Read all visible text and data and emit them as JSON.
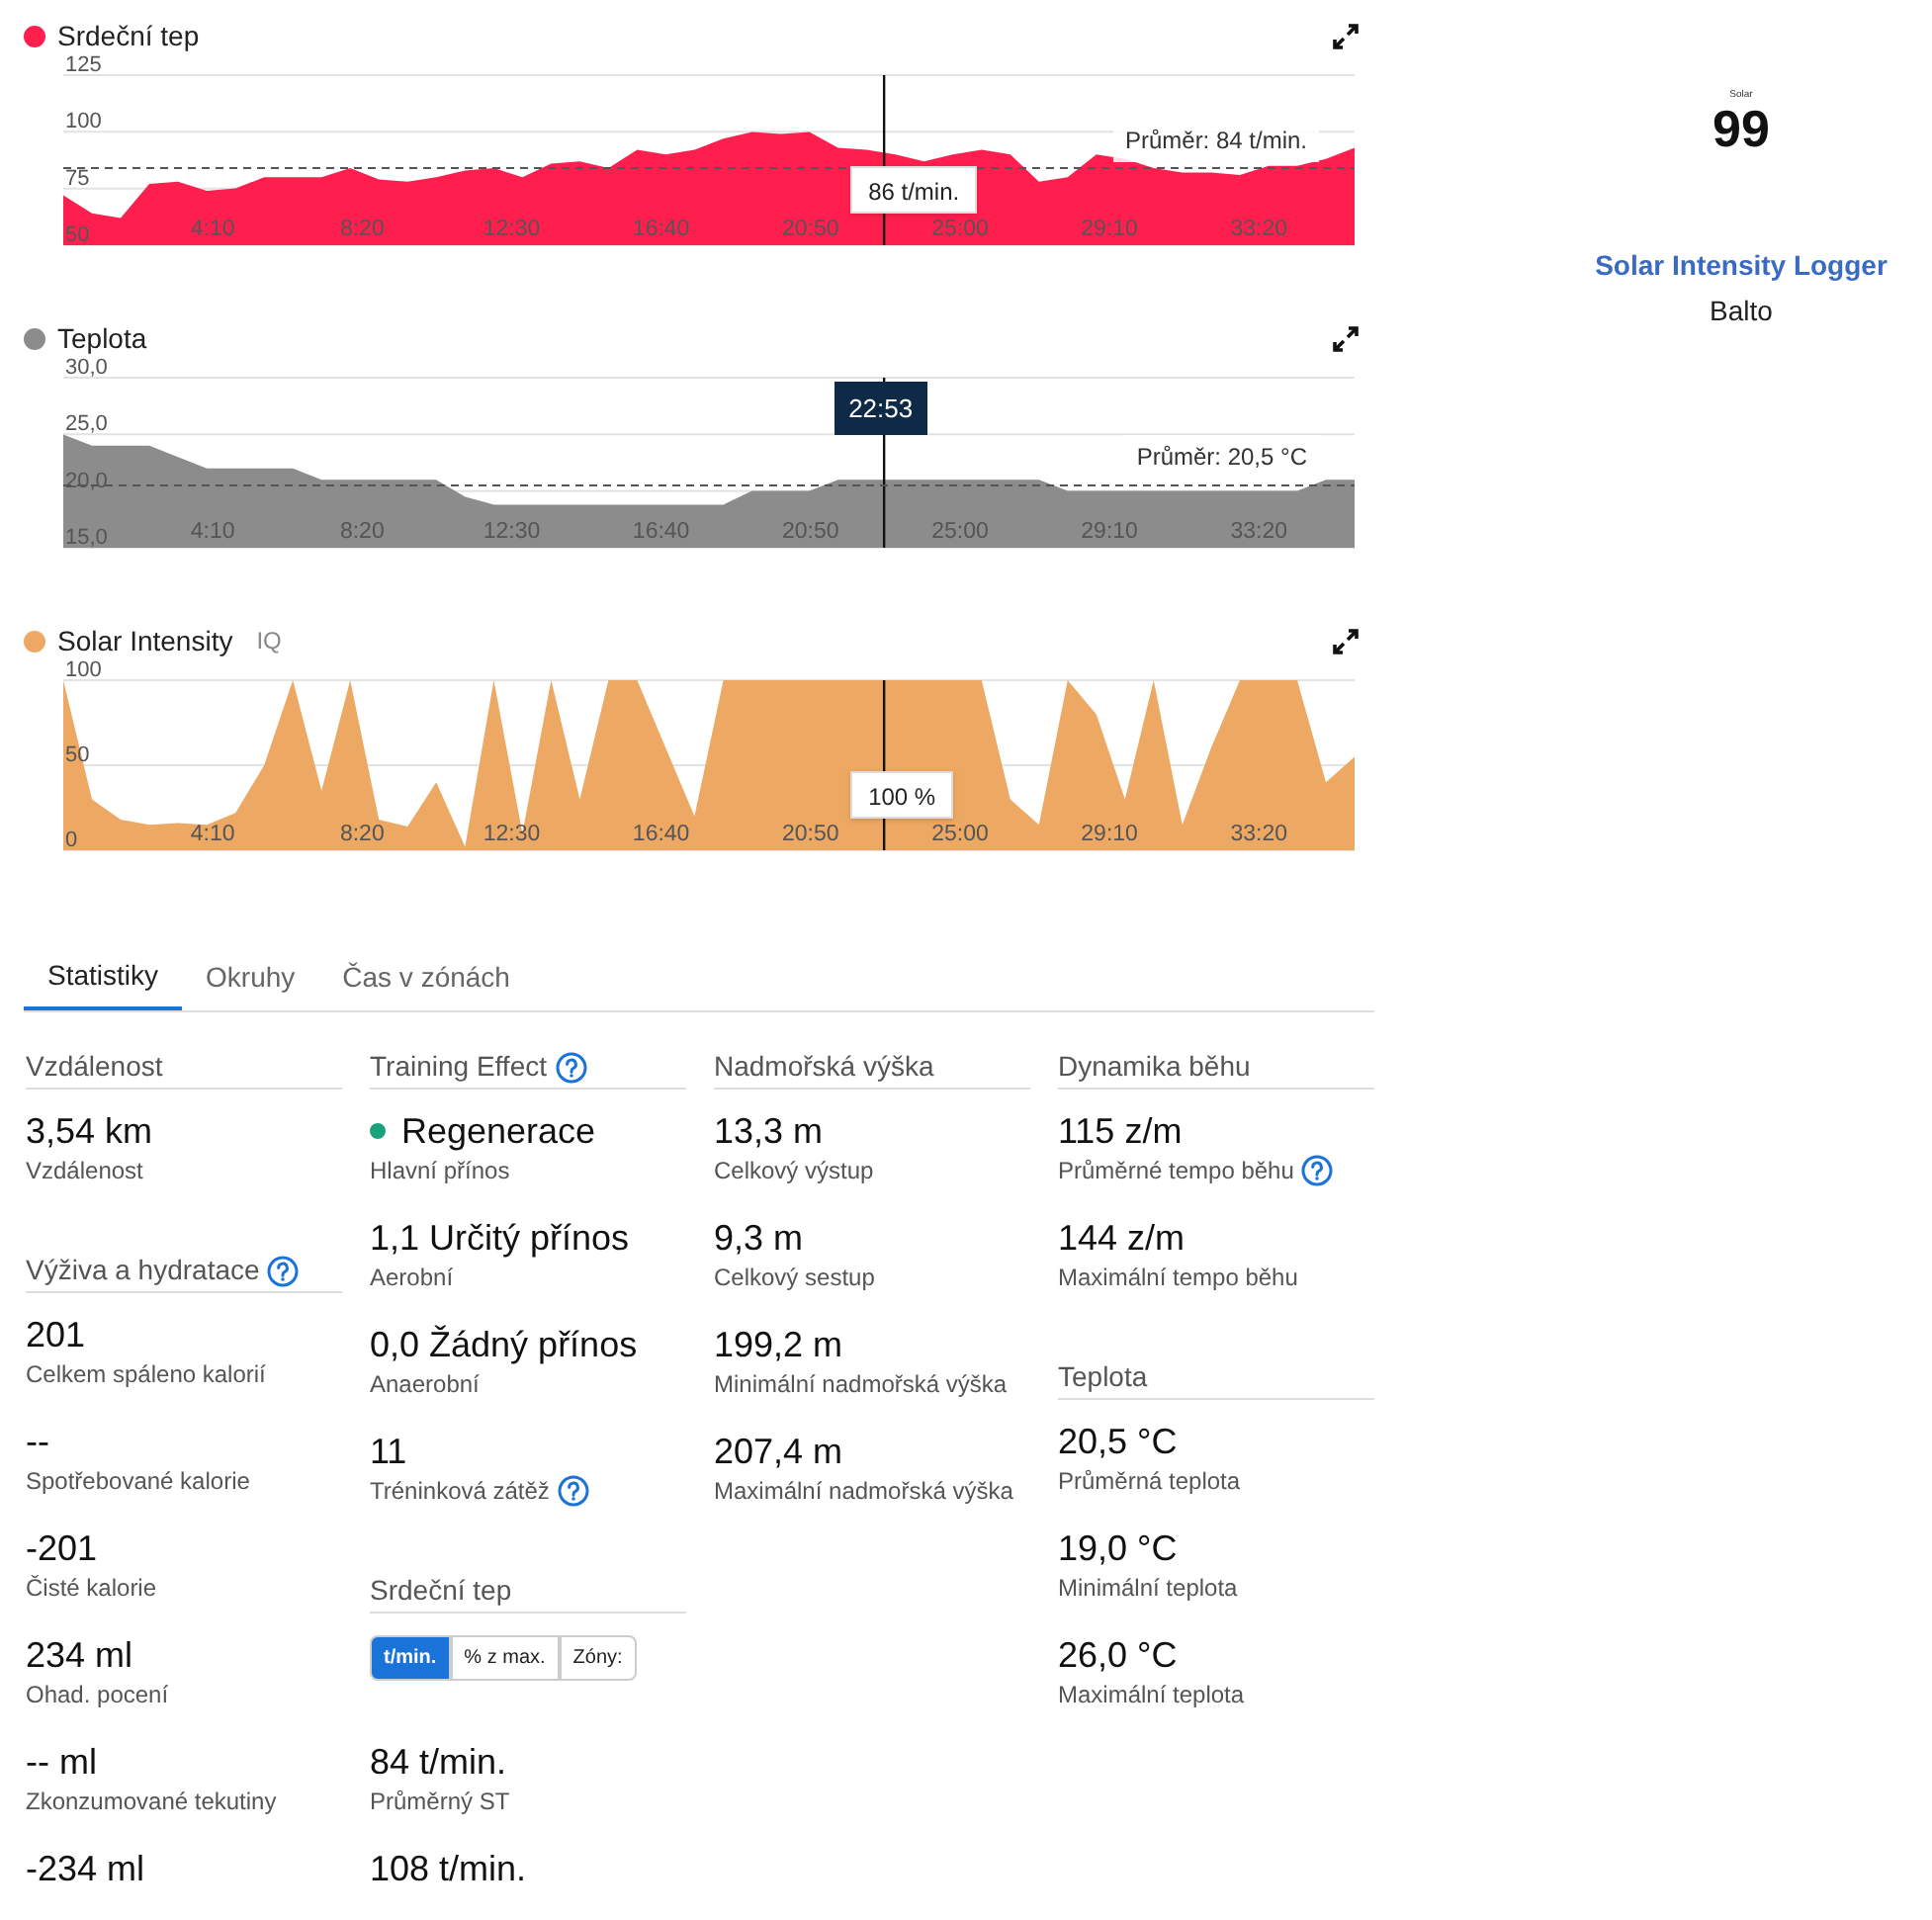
{
  "charts": [
    {
      "tooltip": "86 t/min.",
      "chart_data": {
        "type": "area",
        "xlim": [
          0,
          2160
        ],
        "ylim": [
          50,
          125
        ],
        "yticks": [
          50,
          75,
          100,
          125
        ],
        "xticks": [
          {
            "value": 250,
            "label": "4:10"
          },
          {
            "value": 500,
            "label": "8:20"
          },
          {
            "value": 750,
            "label": "12:30"
          },
          {
            "value": 1000,
            "label": "16:40"
          },
          {
            "value": 1250,
            "label": "20:50"
          },
          {
            "value": 1500,
            "label": "25:00"
          },
          {
            "value": 1750,
            "label": "29:10"
          },
          {
            "value": 2000,
            "label": "33:20"
          }
        ],
        "x": [
          0,
          48,
          96,
          144,
          192,
          240,
          288,
          336,
          384,
          432,
          480,
          528,
          576,
          624,
          672,
          720,
          768,
          816,
          864,
          912,
          960,
          1008,
          1056,
          1104,
          1152,
          1200,
          1248,
          1296,
          1344,
          1392,
          1440,
          1488,
          1536,
          1584,
          1632,
          1680,
          1728,
          1776,
          1824,
          1872,
          1920,
          1968,
          2016,
          2064,
          2112,
          2160
        ],
        "series": [
          {
            "name": "Srdeční tep",
            "color": "#ff1f4f",
            "values": [
              72,
              64,
              62,
              77,
              78,
              74,
              75,
              80,
              80,
              80,
              84,
              79,
              78,
              80,
              83,
              84,
              80,
              86,
              87,
              84,
              92,
              90,
              92,
              97,
              100,
              99,
              100,
              93,
              92,
              90,
              87,
              90,
              92,
              90,
              78,
              80,
              90,
              88,
              84,
              82,
              82,
              81,
              85,
              85,
              88,
              93
            ]
          }
        ],
        "ref_lines": [
          {
            "axis": "x",
            "value": 1373
          },
          {
            "axis": "y",
            "value": 84,
            "label": "Průměr: 84 t/min."
          }
        ]
      }
    },
    {
      "cursor_label": "22:53",
      "chart_data": {
        "type": "area",
        "xlim": [
          0,
          2160
        ],
        "ylim": [
          15,
          30
        ],
        "yticks": [
          {
            "value": 15,
            "label": "15,0"
          },
          {
            "value": 20,
            "label": "20,0"
          },
          {
            "value": 25,
            "label": "25,0"
          },
          {
            "value": 30,
            "label": "30,0"
          }
        ],
        "xticks": [
          {
            "value": 250,
            "label": "4:10"
          },
          {
            "value": 500,
            "label": "8:20"
          },
          {
            "value": 750,
            "label": "12:30"
          },
          {
            "value": 1000,
            "label": "16:40"
          },
          {
            "value": 1250,
            "label": "20:50"
          },
          {
            "value": 1500,
            "label": "25:00"
          },
          {
            "value": 1750,
            "label": "29:10"
          },
          {
            "value": 2000,
            "label": "33:20"
          }
        ],
        "x": [
          0,
          48,
          96,
          144,
          192,
          240,
          288,
          336,
          384,
          432,
          480,
          528,
          576,
          624,
          672,
          720,
          768,
          816,
          864,
          912,
          960,
          1008,
          1056,
          1104,
          1152,
          1200,
          1248,
          1296,
          1344,
          1392,
          1440,
          1488,
          1536,
          1584,
          1632,
          1680,
          1728,
          1776,
          1824,
          1872,
          1920,
          1968,
          2016,
          2064,
          2112,
          2160
        ],
        "series": [
          {
            "name": "Teplota",
            "color": "#8c8c8c",
            "values": [
              25,
              24,
              24,
              24,
              23,
              22,
              22,
              22,
              22,
              21,
              21,
              21,
              21,
              21,
              19.5,
              18.8,
              18.8,
              18.8,
              18.8,
              18.8,
              18.8,
              18.8,
              18.8,
              18.8,
              20,
              20,
              20,
              21,
              21,
              21,
              21,
              21,
              21,
              21,
              21,
              20,
              20,
              20,
              20,
              20,
              20,
              20,
              20,
              20,
              21,
              21
            ]
          }
        ],
        "ref_lines": [
          {
            "axis": "x",
            "value": 1373
          },
          {
            "axis": "y",
            "value": 20.5,
            "label": "Průměr: 20,5 °C"
          }
        ]
      }
    },
    {
      "badge": "IQ",
      "tooltip": "100 %",
      "chart_data": {
        "type": "area",
        "xlim": [
          0,
          2160
        ],
        "ylim": [
          0,
          100
        ],
        "yticks": [
          0,
          50,
          100
        ],
        "xticks": [
          {
            "value": 250,
            "label": "4:10"
          },
          {
            "value": 500,
            "label": "8:20"
          },
          {
            "value": 750,
            "label": "12:30"
          },
          {
            "value": 1000,
            "label": "16:40"
          },
          {
            "value": 1250,
            "label": "20:50"
          },
          {
            "value": 1500,
            "label": "25:00"
          },
          {
            "value": 1750,
            "label": "29:10"
          },
          {
            "value": 2000,
            "label": "33:20"
          }
        ],
        "x": [
          0,
          48,
          96,
          144,
          192,
          240,
          288,
          336,
          384,
          432,
          480,
          528,
          576,
          624,
          672,
          720,
          768,
          816,
          864,
          912,
          960,
          1008,
          1056,
          1104,
          1152,
          1200,
          1248,
          1296,
          1344,
          1392,
          1440,
          1488,
          1536,
          1584,
          1632,
          1680,
          1728,
          1776,
          1824,
          1872,
          1920,
          1968,
          2016,
          2064,
          2112,
          2160
        ],
        "series": [
          {
            "name": "Solar Intensity",
            "color": "#eda863",
            "values": [
              100,
              30,
              18,
              15,
              16,
              15,
              22,
              50,
              100,
              35,
              100,
              18,
              14,
              40,
              2,
              100,
              10,
              100,
              30,
              100,
              100,
              60,
              20,
              100,
              100,
              100,
              100,
              100,
              100,
              100,
              100,
              100,
              100,
              30,
              15,
              100,
              80,
              30,
              100,
              15,
              60,
              100,
              100,
              100,
              40,
              55
            ]
          }
        ],
        "ref_lines": [
          {
            "axis": "x",
            "value": 1373
          }
        ]
      }
    }
  ],
  "device": {
    "logo_caption": "Solar",
    "logo_number": "99",
    "name": "Solar Intensity Logger",
    "owner": "Balto"
  },
  "tabs": [
    {
      "label": "Statistiky",
      "selected": true
    },
    {
      "label": "Okruhy",
      "selected": false
    },
    {
      "label": "Čas v zónách",
      "selected": false
    }
  ],
  "stats": [
    {
      "sections": [
        {
          "title": "Vzdálenost",
          "help": false,
          "items": [
            {
              "value": "3,54 km",
              "label": "Vzdálenost",
              "help": false
            }
          ]
        },
        {
          "title": "Výživa a hydratace",
          "help": true,
          "items": [
            {
              "value": "201",
              "label": "Celkem spáleno kalorií",
              "help": false
            },
            {
              "value": "--",
              "label": "Spotřebované kalorie",
              "help": false
            },
            {
              "value": "-201",
              "label": "Čisté kalorie",
              "help": false
            },
            {
              "value": "234 ml",
              "label": "Ohad. pocení",
              "help": false
            },
            {
              "value": "-- ml",
              "label": "Zkonzumované tekutiny",
              "help": false
            },
            {
              "value": "-234 ml",
              "help": false
            }
          ]
        }
      ]
    },
    {
      "sections": [
        {
          "title": "Training Effect",
          "help": true,
          "items": [
            {
              "value": "Regenerace",
              "label": "Hlavní přínos",
              "help": false,
              "color": "#1aa37a"
            },
            {
              "value": "1,1 Určitý přínos",
              "label": "Aerobní",
              "help": false
            },
            {
              "value": "0,0 Žádný přínos",
              "label": "Anaerobní",
              "help": false
            },
            {
              "value": "11",
              "label": "Tréninková zátěž",
              "help": true
            }
          ]
        },
        {
          "title": "Srdeční tep",
          "help": false,
          "units": [
            {
              "label": "t/min.",
              "selected": true
            },
            {
              "label": "% z max.",
              "selected": false
            },
            {
              "label": "Zóny:",
              "selected": false
            }
          ],
          "items": [
            {
              "value": "84 t/min.",
              "label": "Průměrný ST",
              "help": false
            },
            {
              "value": "108 t/min.",
              "help": false
            }
          ]
        }
      ]
    },
    {
      "sections": [
        {
          "title": "Nadmořská výška",
          "help": false,
          "items": [
            {
              "value": "13,3 m",
              "label": "Celkový výstup",
              "help": false
            },
            {
              "value": "9,3 m",
              "label": "Celkový sestup",
              "help": false
            },
            {
              "value": "199,2 m",
              "label": "Minimální nadmořská výška",
              "help": false
            },
            {
              "value": "207,4 m",
              "label": "Maximální nadmořská výška",
              "help": false
            }
          ]
        }
      ]
    },
    {
      "sections": [
        {
          "title": "Dynamika běhu",
          "help": false,
          "items": [
            {
              "value": "115 z/m",
              "label": "Průměrné tempo běhu",
              "help": true
            },
            {
              "value": "144 z/m",
              "label": "Maximální tempo běhu",
              "help": false
            }
          ]
        },
        {
          "title": "Teplota",
          "help": false,
          "items": [
            {
              "value": "20,5 °C",
              "label": "Průměrná teplota",
              "help": false
            },
            {
              "value": "19,0 °C",
              "label": "Minimální teplota",
              "help": false
            },
            {
              "value": "26,0 °C",
              "label": "Maximální teplota",
              "help": false
            }
          ]
        }
      ]
    }
  ]
}
